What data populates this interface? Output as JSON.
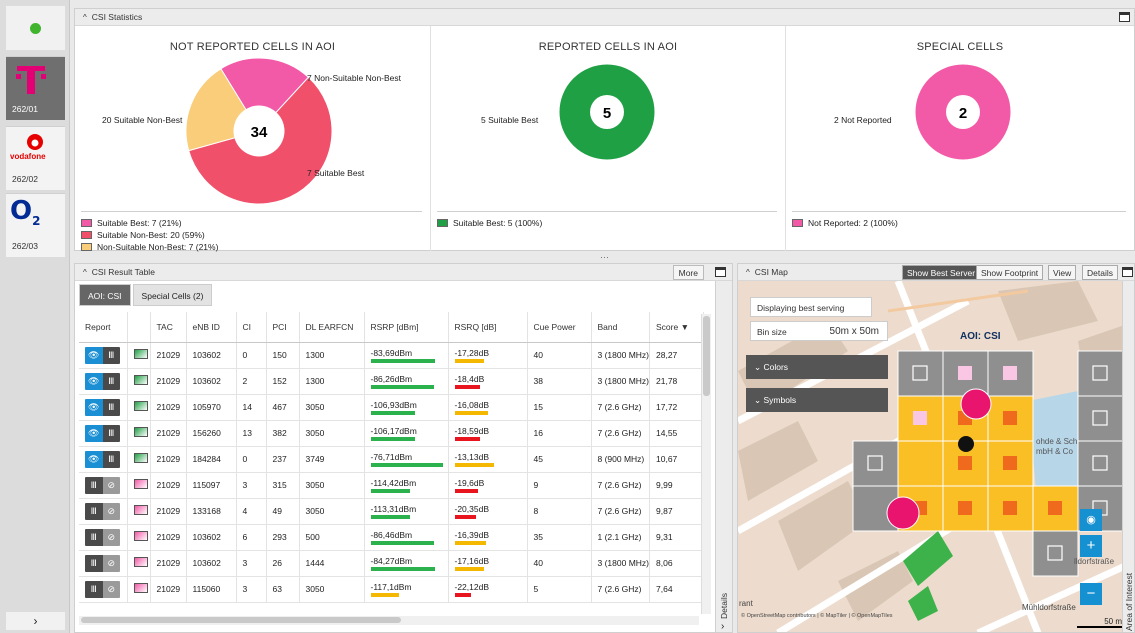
{
  "operators": [
    {
      "name": "T",
      "code": "262/01",
      "color": "#e20074"
    },
    {
      "name": "vodafone",
      "code": "262/02",
      "color": "#e60000"
    },
    {
      "name": "O2",
      "code": "262/03",
      "color": "#032b94"
    }
  ],
  "stats": {
    "title": "CSI Statistics",
    "sections": [
      {
        "title": "NOT REPORTED CELLS IN AOI",
        "total": "34",
        "labels": [
          "7 Non-Suitable Non-Best",
          "20 Suitable Non-Best",
          "7 Suitable Best"
        ],
        "legend": [
          "Suitable Best: 7 (21%)",
          "Suitable Non-Best: 20 (59%)",
          "Non-Suitable Non-Best: 7 (21%)"
        ],
        "slices": [
          {
            "value": 7,
            "color": "#f25aa8"
          },
          {
            "value": 20,
            "color": "#f0506a"
          },
          {
            "value": 7,
            "color": "#f9cd7a"
          }
        ]
      },
      {
        "title": "REPORTED CELLS IN AOI",
        "total": "5",
        "labels": [
          "5 Suitable Best"
        ],
        "legend": [
          "Suitable Best: 5 (100%)"
        ],
        "slices": [
          {
            "value": 5,
            "color": "#1fa044"
          }
        ]
      },
      {
        "title": "SPECIAL CELLS",
        "total": "2",
        "labels": [
          "2 Not Reported"
        ],
        "legend": [
          "Not Reported: 2 (100%)"
        ],
        "slices": [
          {
            "value": 2,
            "color": "#f25aa8"
          }
        ]
      }
    ]
  },
  "table": {
    "title": "CSI Result Table",
    "more": "More",
    "tabs": [
      "AOI: CSI",
      "Special Cells (2)"
    ],
    "columns": [
      "Report",
      "",
      "TAC",
      "eNB ID",
      "CI",
      "PCI",
      "DL EARFCN",
      "RSRP [dBm]",
      "RSRQ [dB]",
      "Cue Power",
      "Band",
      "Score ▼"
    ],
    "details": "Details",
    "rows": [
      {
        "reported": true,
        "tac": "21029",
        "enb": "103602",
        "ci": "0",
        "pci": "150",
        "earfcn": "1300",
        "rsrp": "-83,69dBm",
        "rsrp_pct": 0.9,
        "rsrp_color": "#2bb24c",
        "rsrq": "-17,28dB",
        "rsrq_pct": 0.7,
        "rsrq_color": "#f5b800",
        "cue": "40",
        "band": "3 (1800 MHz)",
        "score": "28,27"
      },
      {
        "reported": true,
        "tac": "21029",
        "enb": "103602",
        "ci": "2",
        "pci": "152",
        "earfcn": "1300",
        "rsrp": "-86,26dBm",
        "rsrp_pct": 0.88,
        "rsrp_color": "#2bb24c",
        "rsrq": "-18,4dB",
        "rsrq_pct": 0.6,
        "rsrq_color": "#e8141e",
        "cue": "38",
        "band": "3 (1800 MHz)",
        "score": "21,78"
      },
      {
        "reported": true,
        "tac": "21029",
        "enb": "105970",
        "ci": "14",
        "pci": "467",
        "earfcn": "3050",
        "rsrp": "-106,93dBm",
        "rsrp_pct": 0.62,
        "rsrp_color": "#2bb24c",
        "rsrq": "-16,08dB",
        "rsrq_pct": 0.8,
        "rsrq_color": "#f5b800",
        "cue": "15",
        "band": "7 (2.6 GHz)",
        "score": "17,72"
      },
      {
        "reported": true,
        "tac": "21029",
        "enb": "156260",
        "ci": "13",
        "pci": "382",
        "earfcn": "3050",
        "rsrp": "-106,17dBm",
        "rsrp_pct": 0.62,
        "rsrp_color": "#2bb24c",
        "rsrq": "-18,59dB",
        "rsrq_pct": 0.6,
        "rsrq_color": "#e8141e",
        "cue": "16",
        "band": "7 (2.6 GHz)",
        "score": "14,55"
      },
      {
        "reported": true,
        "tac": "21029",
        "enb": "184284",
        "ci": "0",
        "pci": "237",
        "earfcn": "3749",
        "rsrp": "-76,71dBm",
        "rsrp_pct": 1.0,
        "rsrp_color": "#2bb24c",
        "rsrq": "-13,13dB",
        "rsrq_pct": 0.95,
        "rsrq_color": "#f5b800",
        "cue": "45",
        "band": "8 (900 MHz)",
        "score": "10,67"
      },
      {
        "reported": false,
        "tac": "21029",
        "enb": "115097",
        "ci": "3",
        "pci": "315",
        "earfcn": "3050",
        "rsrp": "-114,42dBm",
        "rsrp_pct": 0.55,
        "rsrp_color": "#2bb24c",
        "rsrq": "-19,6dB",
        "rsrq_pct": 0.55,
        "rsrq_color": "#e8141e",
        "cue": "9",
        "band": "7 (2.6 GHz)",
        "score": "9,99"
      },
      {
        "reported": false,
        "tac": "21029",
        "enb": "133168",
        "ci": "4",
        "pci": "49",
        "earfcn": "3050",
        "rsrp": "-113,31dBm",
        "rsrp_pct": 0.55,
        "rsrp_color": "#2bb24c",
        "rsrq": "-20,35dB",
        "rsrq_pct": 0.5,
        "rsrq_color": "#e8141e",
        "cue": "8",
        "band": "7 (2.6 GHz)",
        "score": "9,87"
      },
      {
        "reported": false,
        "tac": "21029",
        "enb": "103602",
        "ci": "6",
        "pci": "293",
        "earfcn": "500",
        "rsrp": "-86,46dBm",
        "rsrp_pct": 0.88,
        "rsrp_color": "#2bb24c",
        "rsrq": "-16,39dB",
        "rsrq_pct": 0.75,
        "rsrq_color": "#f5b800",
        "cue": "35",
        "band": "1 (2.1 GHz)",
        "score": "9,31"
      },
      {
        "reported": false,
        "tac": "21029",
        "enb": "103602",
        "ci": "3",
        "pci": "26",
        "earfcn": "1444",
        "rsrp": "-84,27dBm",
        "rsrp_pct": 0.9,
        "rsrp_color": "#2bb24c",
        "rsrq": "-17,16dB",
        "rsrq_pct": 0.7,
        "rsrq_color": "#f5b800",
        "cue": "40",
        "band": "3 (1800 MHz)",
        "score": "8,06"
      },
      {
        "reported": false,
        "tac": "21029",
        "enb": "115060",
        "ci": "3",
        "pci": "63",
        "earfcn": "3050",
        "rsrp": "-117,1dBm",
        "rsrp_pct": 0.4,
        "rsrp_color": "#f5b800",
        "rsrq": "-22,12dB",
        "rsrq_pct": 0.4,
        "rsrq_color": "#e8141e",
        "cue": "5",
        "band": "7 (2.6 GHz)",
        "score": "7,64"
      }
    ]
  },
  "map": {
    "title": "CSI Map",
    "buttons": [
      "Show Best Server",
      "Show Footprint",
      "View",
      "Details"
    ],
    "info1": "Displaying best serving cell(s)",
    "bin_label": "Bin size",
    "bin_value": "50m x 50m",
    "aoi_label": "AOI: CSI",
    "colors_label": "Colors",
    "symbols_label": "Symbols",
    "street1": "Mühldorfstraße",
    "street2": "rant",
    "poi1": "ohde & Sch",
    "poi2": "mbH & Co",
    "poi3": "lldorfstraße",
    "scale": "50 m",
    "attribution": "© OpenStreetMap contributors | © MapTiler | © OpenMapTiles",
    "side_label": "Area of Interest"
  },
  "colors": {
    "reported": "#1fa044",
    "not_reported": "#f25aa8",
    "fill_bin": "#f9bf24",
    "grey_bin": "#8f8f8f"
  }
}
